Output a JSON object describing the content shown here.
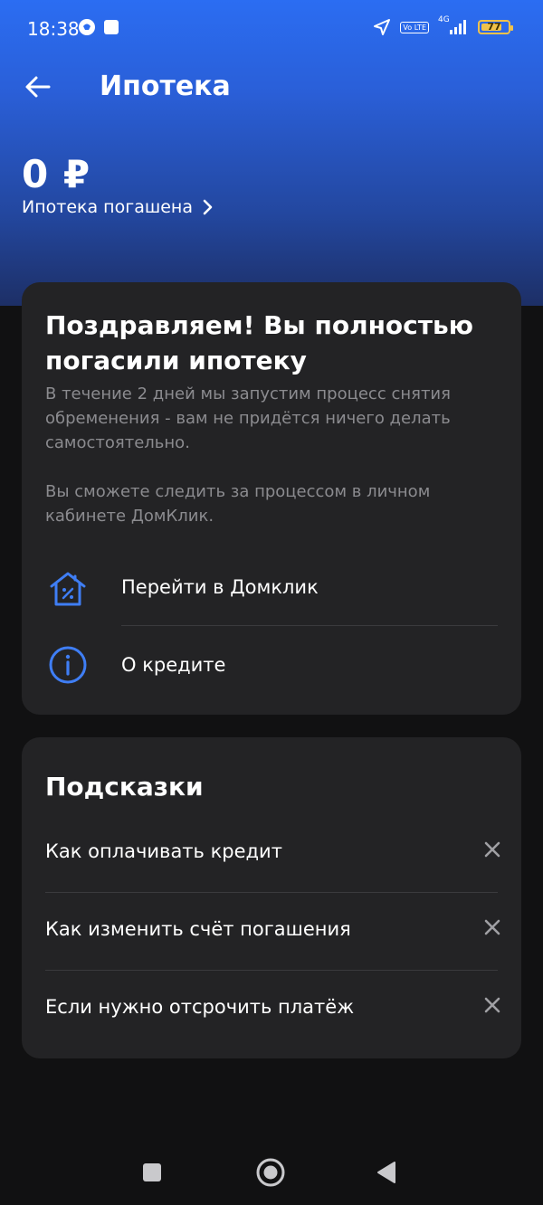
{
  "status_bar": {
    "time": "18:38",
    "volte": "Vo LTE",
    "network": "4G",
    "battery": "77"
  },
  "header": {
    "title": "Ипотека"
  },
  "summary": {
    "balance": "0 ₽",
    "status_link": "Ипотека погашена"
  },
  "main_card": {
    "title": "Поздравляем! Вы полностью погасили ипотеку",
    "description_1": "В течение 2 дней мы запустим процесс снятия обременения - вам не придётся ничего делать самостоятельно.",
    "description_2": "Вы сможете следить за процессом в личном кабинете ДомКлик.",
    "actions": [
      {
        "label": "Перейти в Домклик",
        "icon": "house-percent-icon"
      },
      {
        "label": "О кредите",
        "icon": "info-icon"
      }
    ]
  },
  "tips": {
    "title": "Подсказки",
    "items": [
      {
        "label": "Как оплачивать кредит"
      },
      {
        "label": "Как изменить счёт погашения"
      },
      {
        "label": "Если нужно отсрочить платёж"
      }
    ]
  },
  "colors": {
    "accent_blue": "#2b6df2",
    "card_bg": "#232325",
    "muted_text": "#8b8b8f",
    "icon_blue": "#3f7ef5"
  }
}
